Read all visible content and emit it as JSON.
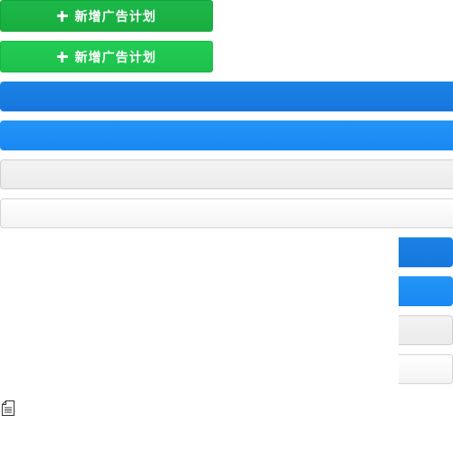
{
  "buttons": {
    "add_plan_primary": {
      "label": "新增广告计划",
      "icon": "plus-icon"
    },
    "add_plan_hover": {
      "label": "新增广告计划",
      "icon": "plus-icon"
    }
  },
  "colors": {
    "green_dark": "#17ae3f",
    "green_light": "#1cc14b",
    "blue_dark": "#1677dd",
    "blue": "#1a88f2",
    "gray": "#ebebeb",
    "white": "#f3f3f3"
  },
  "icons": {
    "document": "document-icon"
  }
}
